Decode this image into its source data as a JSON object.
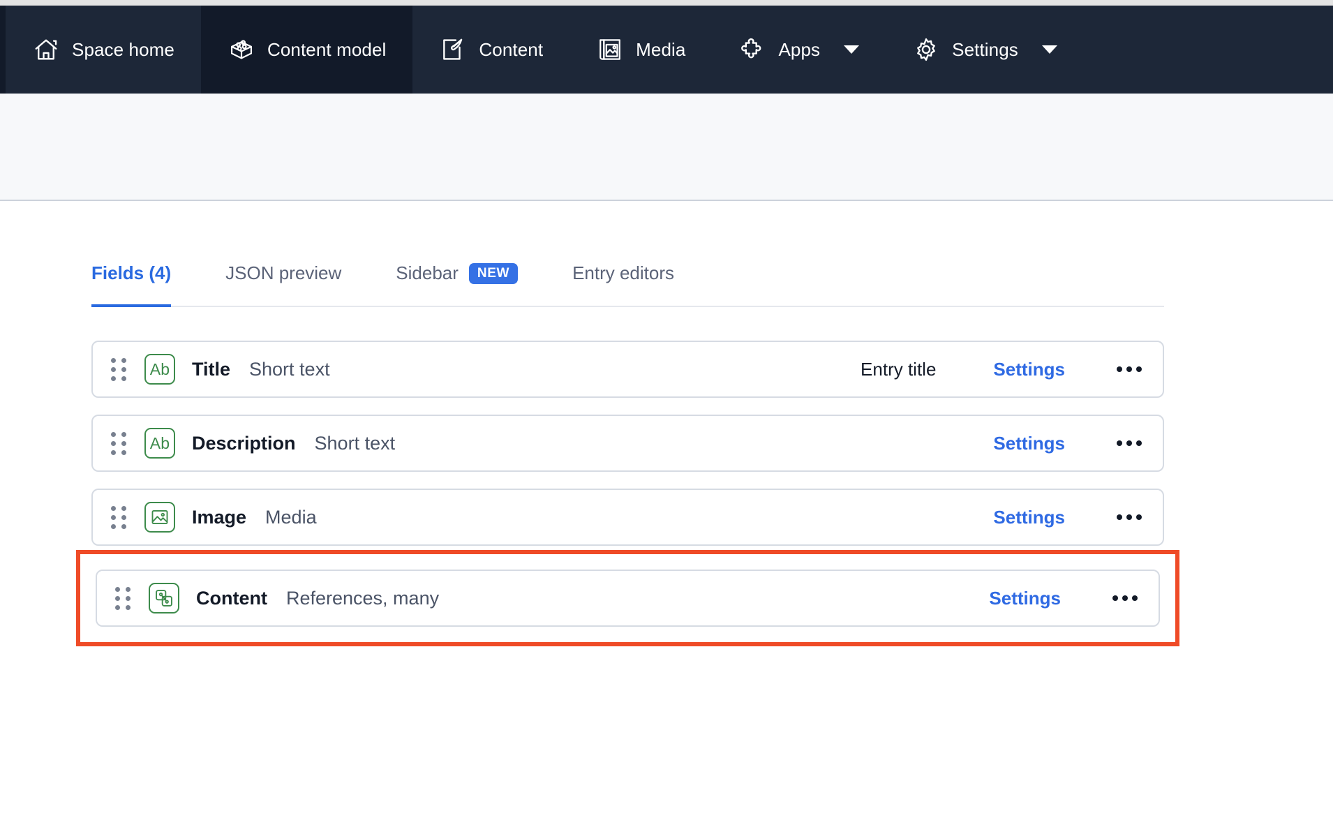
{
  "topnav": {
    "items": [
      {
        "label": "Space home",
        "icon": "home-icon",
        "active": false,
        "caret": false
      },
      {
        "label": "Content model",
        "icon": "content-model-icon",
        "active": true,
        "caret": false
      },
      {
        "label": "Content",
        "icon": "content-icon",
        "active": false,
        "caret": false
      },
      {
        "label": "Media",
        "icon": "media-icon",
        "active": false,
        "caret": false
      },
      {
        "label": "Apps",
        "icon": "apps-icon",
        "active": false,
        "caret": true
      },
      {
        "label": "Settings",
        "icon": "gear-icon",
        "active": false,
        "caret": true
      }
    ]
  },
  "tabs": [
    {
      "label": "Fields (4)",
      "active": true,
      "badge": ""
    },
    {
      "label": "JSON preview",
      "active": false,
      "badge": ""
    },
    {
      "label": "Sidebar",
      "active": false,
      "badge": "NEW"
    },
    {
      "label": "Entry editors",
      "active": false,
      "badge": ""
    }
  ],
  "fields": [
    {
      "name": "Title",
      "type": "Short text",
      "icon": "short-text-icon",
      "icon_glyph": "Ab",
      "entry_title": "Entry title",
      "settings_label": "Settings",
      "highlighted": false
    },
    {
      "name": "Description",
      "type": "Short text",
      "icon": "short-text-icon",
      "icon_glyph": "Ab",
      "entry_title": "",
      "settings_label": "Settings",
      "highlighted": false
    },
    {
      "name": "Image",
      "type": "Media",
      "icon": "media-field-icon",
      "icon_glyph": "",
      "entry_title": "",
      "settings_label": "Settings",
      "highlighted": false
    },
    {
      "name": "Content",
      "type": "References, many",
      "icon": "references-icon",
      "icon_glyph": "",
      "entry_title": "",
      "settings_label": "Settings",
      "highlighted": true
    }
  ],
  "colors": {
    "nav_background": "#1d2738",
    "nav_active": "#121a29",
    "accent_blue": "#2f6ae3",
    "badge_blue": "#3571e5",
    "icon_green": "#3d8b4b",
    "highlight_red": "#ef4b27",
    "subheader": "#f7f8fa"
  }
}
